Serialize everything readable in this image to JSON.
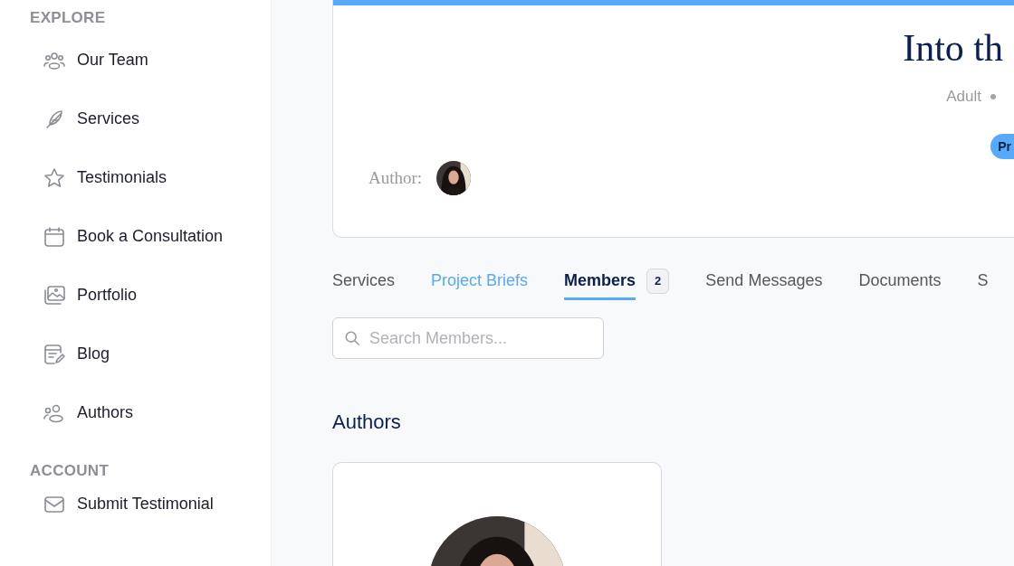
{
  "sidebar": {
    "sections": [
      {
        "heading": "EXPLORE",
        "items": [
          {
            "label": "Our Team"
          },
          {
            "label": "Services"
          },
          {
            "label": "Testimonials"
          },
          {
            "label": "Book a Consultation"
          },
          {
            "label": "Portfolio"
          },
          {
            "label": "Blog"
          },
          {
            "label": "Authors"
          }
        ]
      },
      {
        "heading": "ACCOUNT",
        "items": [
          {
            "label": "Submit Testimonial"
          }
        ]
      }
    ]
  },
  "project": {
    "title": "Into th",
    "meta": "Adult",
    "badge": "Pr",
    "author_label": "Author:"
  },
  "tabs": [
    {
      "label": "Services",
      "selected": false,
      "hovered": false
    },
    {
      "label": "Project Briefs",
      "selected": false,
      "hovered": true
    },
    {
      "label": "Members",
      "selected": true,
      "hovered": false,
      "count": "2"
    },
    {
      "label": "Send Messages",
      "selected": false,
      "hovered": false
    },
    {
      "label": "Documents",
      "selected": false,
      "hovered": false
    },
    {
      "label": "S",
      "selected": false,
      "hovered": false
    }
  ],
  "search": {
    "placeholder": "Search Members..."
  },
  "authors_heading": "Authors"
}
